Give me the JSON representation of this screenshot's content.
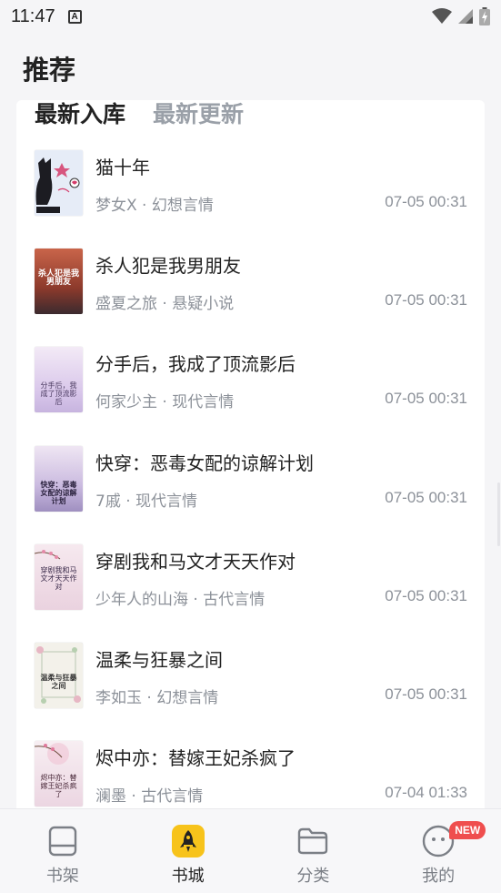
{
  "status_bar": {
    "time": "11:47",
    "app_icon_letter": "A"
  },
  "header": {
    "title": "推荐"
  },
  "tabs": [
    {
      "label": "最新入库",
      "active": true
    },
    {
      "label": "最新更新",
      "active": false
    }
  ],
  "books": [
    {
      "title": "猫十年",
      "author": "梦女X",
      "category": "幻想言情",
      "meta": "梦女X · 幻想言情",
      "updated": "07-05 00:31",
      "cover_text": "",
      "cover_color": "#e9eef8"
    },
    {
      "title": "杀人犯是我男朋友",
      "author": "盛夏之旅",
      "category": "悬疑小说",
      "meta": "盛夏之旅 · 悬疑小说",
      "updated": "07-05 00:31",
      "cover_text": "杀人犯是我男朋友",
      "cover_color": "#b0503a"
    },
    {
      "title": "分手后，我成了顶流影后",
      "author": "何家少主",
      "category": "现代言情",
      "meta": "何家少主 · 现代言情",
      "updated": "07-05 00:31",
      "cover_text": "分手后，我成了顶流影后",
      "cover_color": "#e3d6ef"
    },
    {
      "title": "快穿：恶毒女配的谅解计划",
      "author": "7戚",
      "category": "现代言情",
      "meta": "7戚 · 现代言情",
      "updated": "07-05 00:31",
      "cover_text": "快穿：恶毒女配的谅解计划",
      "cover_color": "#d9cfe8"
    },
    {
      "title": "穿剧我和马文才天天作对",
      "author": "少年人的山海",
      "category": "古代言情",
      "meta": "少年人的山海 · 古代言情",
      "updated": "07-05 00:31",
      "cover_text": "穿剧我和马文才天天作对",
      "cover_color": "#eedbe6"
    },
    {
      "title": "温柔与狂暴之间",
      "author": "李如玉",
      "category": "幻想言情",
      "meta": "李如玉 · 幻想言情",
      "updated": "07-05 00:31",
      "cover_text": "温柔与狂暴之间",
      "cover_color": "#f2f0ea"
    },
    {
      "title": "烬中亦：替嫁王妃杀疯了",
      "author": "澜墨",
      "category": "古代言情",
      "meta": "澜墨 · 古代言情",
      "updated": "07-04 01:33",
      "cover_text": "烬中亦：替嫁王妃杀疯了",
      "cover_color": "#f1e4ec"
    }
  ],
  "bottom_nav": [
    {
      "label": "书架",
      "icon": "bookshelf-icon",
      "active": false
    },
    {
      "label": "书城",
      "icon": "rocket-icon",
      "active": true
    },
    {
      "label": "分类",
      "icon": "folder-icon",
      "active": false
    },
    {
      "label": "我的",
      "icon": "profile-face-icon",
      "active": false,
      "badge": "NEW"
    }
  ],
  "colors": {
    "accent": "#f7c31b",
    "badge": "#ef4e4e",
    "inactive_tab": "#9aa0a8",
    "meta_text": "#8c9199"
  }
}
